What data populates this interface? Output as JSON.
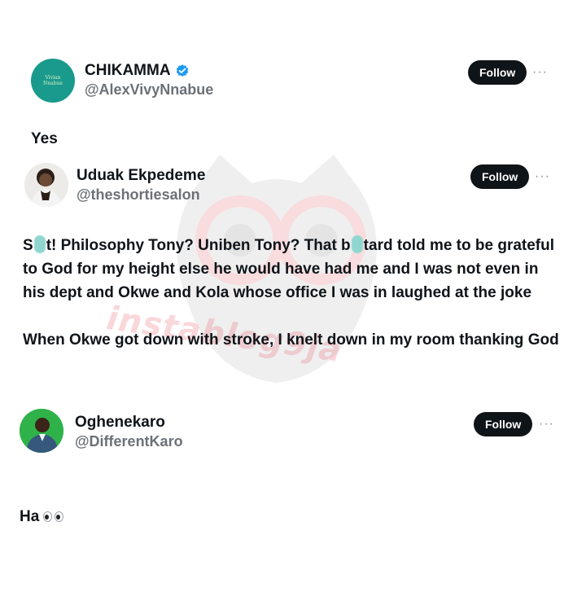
{
  "tweets": [
    {
      "name": "CHIKAMMA",
      "handle": "@AlexVivyNnabue",
      "verified": true,
      "follow_label": "Follow",
      "avatar_logo_text": "Vivian Nnabue",
      "text": "Yes"
    },
    {
      "name": "Uduak Ekpedeme",
      "handle": "@theshortiesalon",
      "verified": false,
      "follow_label": "Follow",
      "text_parts": {
        "p1": "S",
        "p2": "t! Philosophy Tony? Uniben Tony? That b",
        "p3": "tard told me to be grateful to God for my height else he would have had me and I was not even in his dept and Okwe and Kola whose office I was in laughed at the joke",
        "p4": "When Okwe got down with stroke, I knelt down in my room thanking God"
      }
    },
    {
      "name": "Oghenekaro",
      "handle": "@DifferentKaro",
      "verified": false,
      "follow_label": "Follow",
      "text": "Ha"
    }
  ],
  "more_label": "···",
  "watermark_text": "instablog9ja",
  "colors": {
    "follow_bg": "#0f1419",
    "handle": "#6b7177",
    "verified": "#1d9bf0",
    "watermark": "#e8646f",
    "censor": "#8fd6cf",
    "avatar1_bg": "#1a9a8c"
  },
  "icons": [
    "verified-badge-icon",
    "more-options-icon",
    "eyes-emoji-icon"
  ]
}
